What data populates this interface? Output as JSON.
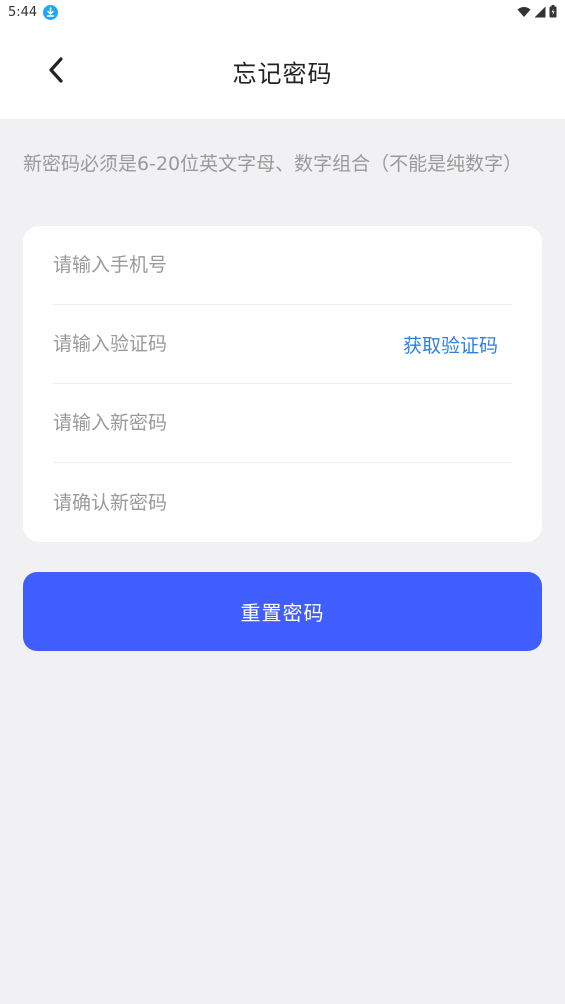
{
  "status_bar": {
    "time": "5:44",
    "icons": [
      "download-icon",
      "wifi-icon",
      "signal-icon",
      "battery-icon"
    ]
  },
  "header": {
    "title": "忘记密码",
    "back_icon": "chevron-left-icon"
  },
  "hint": {
    "text": "新密码必须是6-20位英文字母、数字组合（不能是纯数字）"
  },
  "form": {
    "phone_placeholder": "请输入手机号",
    "code_placeholder": "请输入验证码",
    "get_code_label": "获取验证码",
    "new_password_placeholder": "请输入新密码",
    "confirm_password_placeholder": "请确认新密码"
  },
  "submit": {
    "label": "重置密码"
  },
  "colors": {
    "accent": "#405dfd",
    "link": "#2f80e0",
    "background": "#f1f1f3",
    "hint_text": "#9a9a9a"
  }
}
